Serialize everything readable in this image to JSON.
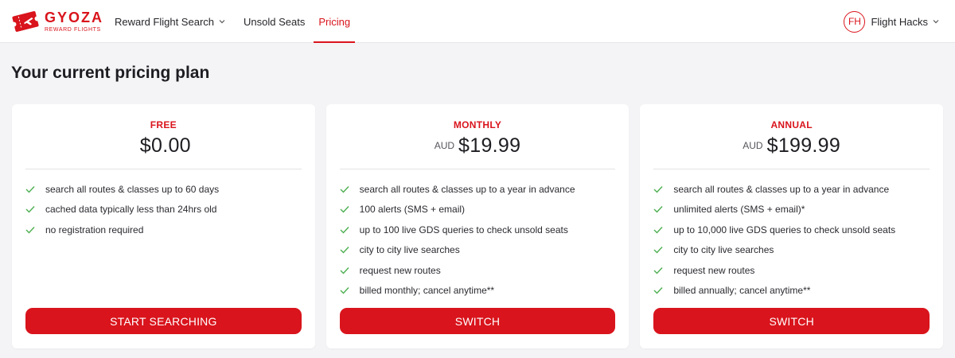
{
  "brand": {
    "name": "GYOZA",
    "tagline": "REWARD FLIGHTS",
    "color": "#d9141c"
  },
  "nav": {
    "items": [
      {
        "label": "Reward Flight Search",
        "has_dropdown": true,
        "active": false
      },
      {
        "label": "Unsold Seats",
        "has_dropdown": false,
        "active": false
      },
      {
        "label": "Pricing",
        "has_dropdown": false,
        "active": true
      }
    ]
  },
  "user": {
    "initials": "FH",
    "name": "Flight Hacks",
    "has_dropdown": true
  },
  "page": {
    "title": "Your current pricing plan"
  },
  "plans": [
    {
      "name": "FREE",
      "currency": "",
      "price": "$0.00",
      "features": [
        "search all routes & classes up to 60 days",
        "cached data typically less than 24hrs old",
        "no registration required"
      ],
      "button": "START SEARCHING"
    },
    {
      "name": "MONTHLY",
      "currency": "AUD",
      "price": "$19.99",
      "features": [
        "search all routes & classes up to a year in advance",
        "100 alerts (SMS + email)",
        "up to 100 live GDS queries to check unsold seats",
        "city to city live searches",
        "request new routes",
        "billed monthly; cancel anytime**"
      ],
      "button": "SWITCH"
    },
    {
      "name": "ANNUAL",
      "currency": "AUD",
      "price": "$199.99",
      "features": [
        "search all routes & classes up to a year in advance",
        "unlimited alerts (SMS + email)*",
        "up to 10,000 live GDS queries to check unsold seats",
        "city to city live searches",
        "request new routes",
        "billed annually; cancel anytime**"
      ],
      "button": "SWITCH"
    }
  ],
  "icons": {
    "feature": "check-icon",
    "dropdown": "chevron-down-icon",
    "logo": "ticket-logo-icon"
  },
  "colors": {
    "accent": "#d9141c",
    "check": "#4caf50",
    "background": "#f4f4f6"
  }
}
